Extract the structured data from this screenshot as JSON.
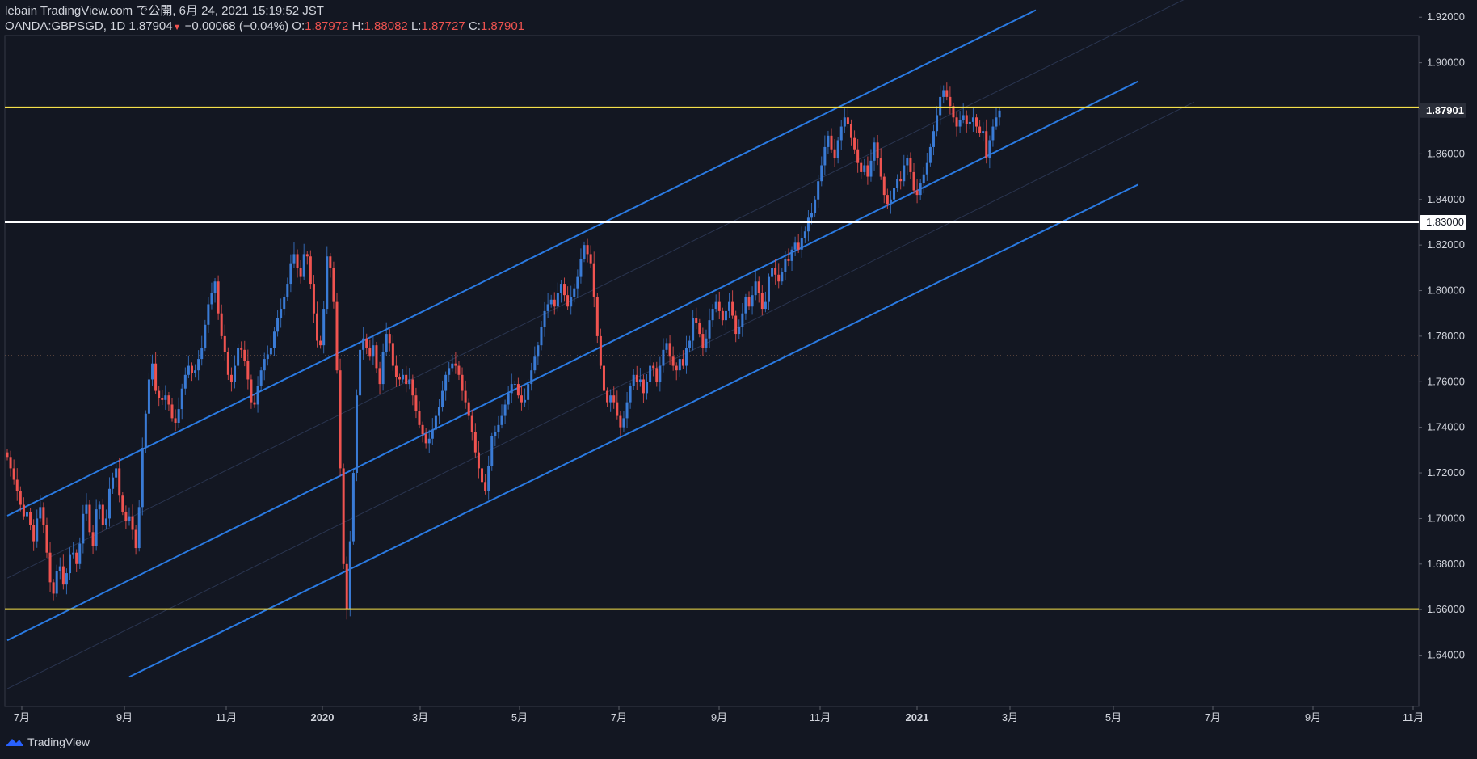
{
  "header": {
    "line1": "lebain TradingView.com で公開, 6月 24, 2021 15:19:52 JST",
    "symbol": "OANDA:GBPSGD, 1D",
    "last": "1.87904",
    "change": "−0.00068 (−0.04%)",
    "o_label": "O:",
    "o_val": "1.87972",
    "h_label": "H:",
    "h_val": "1.88082",
    "l_label": "L:",
    "l_val": "1.87727",
    "c_label": "C:",
    "c_val": "1.87901"
  },
  "footer": {
    "brand": "TradingView"
  },
  "colors": {
    "bg": "#131722",
    "up": "#2962ff",
    "up_light": "#3a7bd5",
    "down": "#ef5350",
    "channel": "#2a7ae2",
    "yellow": "#f5e04a",
    "white": "#ffffff"
  },
  "chart_data": {
    "type": "candlestick",
    "ylim": [
      1.63,
      1.925
    ],
    "y_ticks": [
      "1.92000",
      "1.90000",
      "1.88000",
      "1.86000",
      "1.84000",
      "1.82000",
      "1.80000",
      "1.78000",
      "1.76000",
      "1.74000",
      "1.72000",
      "1.70000",
      "1.68000",
      "1.66000",
      "1.64000"
    ],
    "x_ticks": [
      {
        "label": "7月",
        "bold": false
      },
      {
        "label": "9月",
        "bold": false
      },
      {
        "label": "11月",
        "bold": false
      },
      {
        "label": "2020",
        "bold": true
      },
      {
        "label": "3月",
        "bold": false
      },
      {
        "label": "5月",
        "bold": false
      },
      {
        "label": "7月",
        "bold": false
      },
      {
        "label": "9月",
        "bold": false
      },
      {
        "label": "11月",
        "bold": false
      },
      {
        "label": "2021",
        "bold": true
      },
      {
        "label": "3月",
        "bold": false
      },
      {
        "label": "5月",
        "bold": false
      },
      {
        "label": "7月",
        "bold": false
      },
      {
        "label": "9月",
        "bold": false
      },
      {
        "label": "11月",
        "bold": false
      }
    ],
    "price_labels": [
      {
        "value": 1.87901,
        "text": "1.87901",
        "style": "dark"
      },
      {
        "value": 1.83,
        "text": "1.83000",
        "style": "white"
      }
    ],
    "horizontal_lines": [
      {
        "value": 1.8804,
        "color": "yellow"
      },
      {
        "value": 1.83,
        "color": "white"
      },
      {
        "value": 1.6602,
        "color": "yellow"
      }
    ],
    "close_series": [
      1.727,
      1.722,
      1.717,
      1.712,
      1.706,
      1.701,
      1.703,
      1.697,
      1.69,
      1.7,
      1.705,
      1.697,
      1.685,
      1.672,
      1.667,
      1.677,
      1.679,
      1.671,
      1.676,
      1.684,
      1.685,
      1.68,
      1.689,
      1.702,
      1.706,
      1.694,
      1.688,
      1.704,
      1.706,
      1.697,
      1.7,
      1.713,
      1.718,
      1.722,
      1.71,
      1.703,
      1.699,
      1.701,
      1.695,
      1.687,
      1.705,
      1.731,
      1.746,
      1.761,
      1.768,
      1.756,
      1.753,
      1.752,
      1.754,
      1.75,
      1.744,
      1.742,
      1.748,
      1.757,
      1.763,
      1.767,
      1.764,
      1.765,
      1.77,
      1.775,
      1.785,
      1.794,
      1.799,
      1.804,
      1.79,
      1.78,
      1.773,
      1.763,
      1.76,
      1.767,
      1.775,
      1.774,
      1.769,
      1.761,
      1.751,
      1.75,
      1.758,
      1.765,
      1.77,
      1.772,
      1.775,
      1.782,
      1.788,
      1.792,
      1.797,
      1.803,
      1.812,
      1.816,
      1.81,
      1.806,
      1.816,
      1.815,
      1.803,
      1.79,
      1.778,
      1.776,
      1.792,
      1.815,
      1.81,
      1.795,
      1.765,
      1.722,
      1.68,
      1.66,
      1.69,
      1.72,
      1.754,
      1.774,
      1.779,
      1.775,
      1.771,
      1.776,
      1.766,
      1.759,
      1.773,
      1.781,
      1.777,
      1.767,
      1.762,
      1.761,
      1.763,
      1.759,
      1.761,
      1.754,
      1.747,
      1.741,
      1.737,
      1.733,
      1.735,
      1.739,
      1.745,
      1.749,
      1.756,
      1.763,
      1.766,
      1.768,
      1.767,
      1.763,
      1.756,
      1.751,
      1.745,
      1.738,
      1.729,
      1.722,
      1.716,
      1.712,
      1.723,
      1.736,
      1.738,
      1.741,
      1.745,
      1.75,
      1.755,
      1.759,
      1.759,
      1.754,
      1.751,
      1.752,
      1.759,
      1.765,
      1.771,
      1.776,
      1.784,
      1.791,
      1.794,
      1.796,
      1.793,
      1.799,
      1.803,
      1.798,
      1.793,
      1.797,
      1.801,
      1.806,
      1.814,
      1.82,
      1.816,
      1.812,
      1.797,
      1.78,
      1.767,
      1.756,
      1.751,
      1.754,
      1.751,
      1.745,
      1.74,
      1.744,
      1.751,
      1.758,
      1.763,
      1.76,
      1.761,
      1.755,
      1.76,
      1.767,
      1.766,
      1.76,
      1.767,
      1.774,
      1.777,
      1.771,
      1.767,
      1.765,
      1.77,
      1.767,
      1.775,
      1.778,
      1.788,
      1.786,
      1.781,
      1.775,
      1.779,
      1.787,
      1.792,
      1.795,
      1.791,
      1.787,
      1.791,
      1.795,
      1.789,
      1.781,
      1.784,
      1.79,
      1.797,
      1.793,
      1.798,
      1.804,
      1.799,
      1.792,
      1.795,
      1.806,
      1.81,
      1.807,
      1.804,
      1.808,
      1.814,
      1.813,
      1.818,
      1.821,
      1.818,
      1.823,
      1.826,
      1.832,
      1.834,
      1.84,
      1.848,
      1.855,
      1.863,
      1.868,
      1.862,
      1.858,
      1.866,
      1.872,
      1.876,
      1.873,
      1.867,
      1.862,
      1.856,
      1.852,
      1.855,
      1.85,
      1.857,
      1.865,
      1.858,
      1.85,
      1.842,
      1.838,
      1.84,
      1.845,
      1.849,
      1.848,
      1.855,
      1.858,
      1.852,
      1.844,
      1.842,
      1.847,
      1.851,
      1.856,
      1.863,
      1.87,
      1.877,
      1.885,
      1.888,
      1.885,
      1.881,
      1.876,
      1.872,
      1.875,
      1.877,
      1.873,
      1.874,
      1.876,
      1.872,
      1.869,
      1.87,
      1.858,
      1.866,
      1.872,
      1.876,
      1.879
    ],
    "channel_lines": [
      {
        "name": "upper",
        "from": [
          0,
          1.7012
        ],
        "to": [
          312,
          1.9231
        ]
      },
      {
        "name": "middle",
        "from": [
          0,
          1.6465
        ],
        "to": [
          343,
          1.8918
        ]
      },
      {
        "name": "lower",
        "from": [
          37,
          1.6305
        ],
        "to": [
          343,
          1.8465
        ]
      }
    ],
    "current_marker": 1.7715
  }
}
